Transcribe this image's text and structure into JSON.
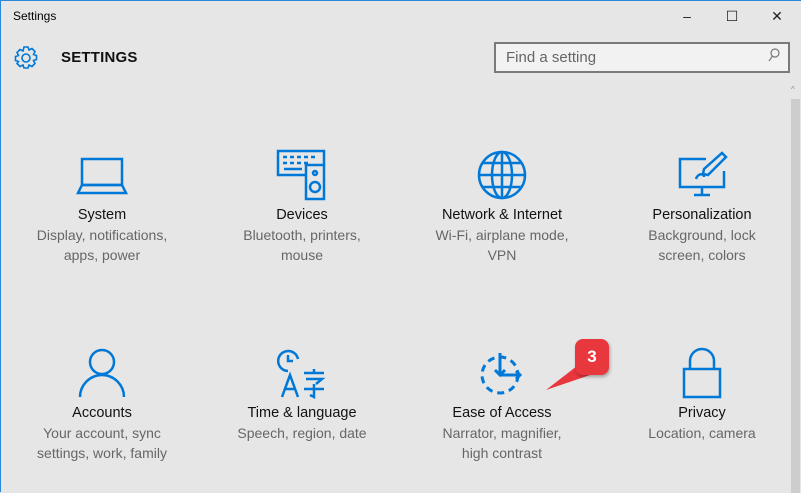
{
  "window": {
    "title": "Settings",
    "minimize": "–",
    "maximize": "☐",
    "close": "✕"
  },
  "header": {
    "title": "SETTINGS",
    "icon": "gear-icon"
  },
  "search": {
    "placeholder": "Find a setting",
    "icon": "search-icon"
  },
  "tiles": [
    {
      "label": "System",
      "desc1": "Display, notifications,",
      "desc2": "apps, power",
      "icon": "laptop-icon"
    },
    {
      "label": "Devices",
      "desc1": "Bluetooth, printers,",
      "desc2": "mouse",
      "icon": "devices-icon"
    },
    {
      "label": "Network & Internet",
      "desc1": "Wi-Fi, airplane mode,",
      "desc2": "VPN",
      "icon": "globe-icon"
    },
    {
      "label": "Personalization",
      "desc1": "Background, lock",
      "desc2": "screen, colors",
      "icon": "paint-icon"
    },
    {
      "label": "Accounts",
      "desc1": "Your account, sync",
      "desc2": "settings, work, family",
      "icon": "person-icon"
    },
    {
      "label": "Time & language",
      "desc1": "Speech, region, date",
      "desc2": "",
      "icon": "time-language-icon"
    },
    {
      "label": "Ease of Access",
      "desc1": "Narrator, magnifier,",
      "desc2": "high contrast",
      "icon": "ease-of-access-icon"
    },
    {
      "label": "Privacy",
      "desc1": "Location, camera",
      "desc2": "",
      "icon": "lock-icon"
    }
  ],
  "annotation": {
    "step": "3"
  },
  "colors": {
    "accent": "#0078d7",
    "badge": "#e8373d"
  }
}
